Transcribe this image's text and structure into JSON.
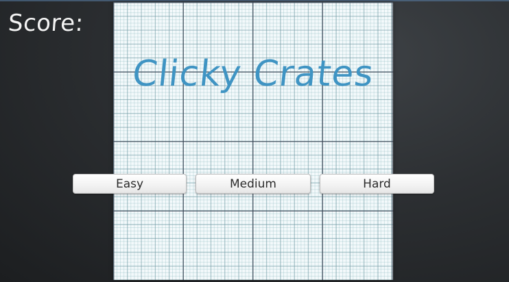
{
  "hud": {
    "score_label": "Score:"
  },
  "title": "Clicky Crates",
  "difficulty_buttons": [
    {
      "label": "Easy"
    },
    {
      "label": "Medium"
    },
    {
      "label": "Hard"
    }
  ],
  "colors": {
    "title": "#3f94c3",
    "score_text": "#f4f4f4",
    "background": "#2c2f32",
    "board_paper": "#f3f9fb"
  }
}
